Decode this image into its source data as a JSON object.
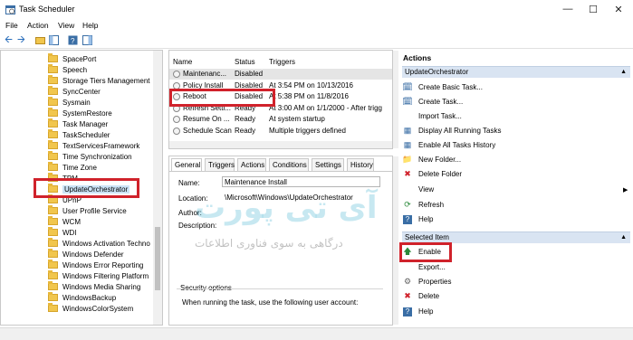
{
  "window": {
    "title": "Task Scheduler"
  },
  "menu": {
    "file": "File",
    "action": "Action",
    "view": "View",
    "help": "Help"
  },
  "tree": {
    "items": [
      "SpacePort",
      "Speech",
      "Storage Tiers Management",
      "SyncCenter",
      "Sysmain",
      "SystemRestore",
      "Task Manager",
      "TaskScheduler",
      "TextServicesFramework",
      "Time Synchronization",
      "Time Zone",
      "TPM",
      "UpdateOrchestrator",
      "UPnP",
      "User Profile Service",
      "WCM",
      "WDI",
      "Windows Activation Techno",
      "Windows Defender",
      "Windows Error Reporting",
      "Windows Filtering Platform",
      "Windows Media Sharing",
      "WindowsBackup",
      "WindowsColorSystem"
    ],
    "selected": "UpdateOrchestrator"
  },
  "tasklist": {
    "columns": {
      "name": "Name",
      "status": "Status",
      "triggers": "Triggers"
    },
    "rows": [
      {
        "name": "Maintenanc...",
        "status": "Disabled",
        "triggers": ""
      },
      {
        "name": "Policy Install",
        "status": "Disabled",
        "triggers": "At 3:54 PM on 10/13/2016"
      },
      {
        "name": "Reboot",
        "status": "Disabled",
        "triggers": "At 5:38 PM on 11/8/2016"
      },
      {
        "name": "Refresh Setti...",
        "status": "Ready",
        "triggers": "At 3:00 AM on 1/1/2000 - After trigg"
      },
      {
        "name": "Resume On ...",
        "status": "Ready",
        "triggers": "At system startup"
      },
      {
        "name": "Schedule Scan",
        "status": "Ready",
        "triggers": "Multiple triggers defined"
      }
    ]
  },
  "details": {
    "tabs": [
      "General",
      "Triggers",
      "Actions",
      "Conditions",
      "Settings",
      "History"
    ],
    "name_label": "Name:",
    "name_value": "Maintenance Install",
    "location_label": "Location:",
    "location_value": "\\Microsoft\\Windows\\UpdateOrchestrator",
    "author_label": "Author:",
    "description_label": "Description:",
    "security_label": "Security options",
    "security_text": "When running the task, use the following user account:"
  },
  "actions": {
    "header": "Actions",
    "section1": "UpdateOrchestrator",
    "items1": [
      "Create Basic Task...",
      "Create Task...",
      "Import Task...",
      "Display All Running Tasks",
      "Enable All Tasks History",
      "New Folder...",
      "Delete Folder",
      "View",
      "Refresh",
      "Help"
    ],
    "section2": "Selected Item",
    "items2": [
      "Enable",
      "Export...",
      "Properties",
      "Delete",
      "Help"
    ]
  },
  "watermark": {
    "logo": "آی تی پورت",
    "tagline": "درگاهی به سوی فناوری اطلاعات"
  },
  "colors": {
    "highlight_red": "#d0222b",
    "section_header": "#d9e4f2"
  }
}
